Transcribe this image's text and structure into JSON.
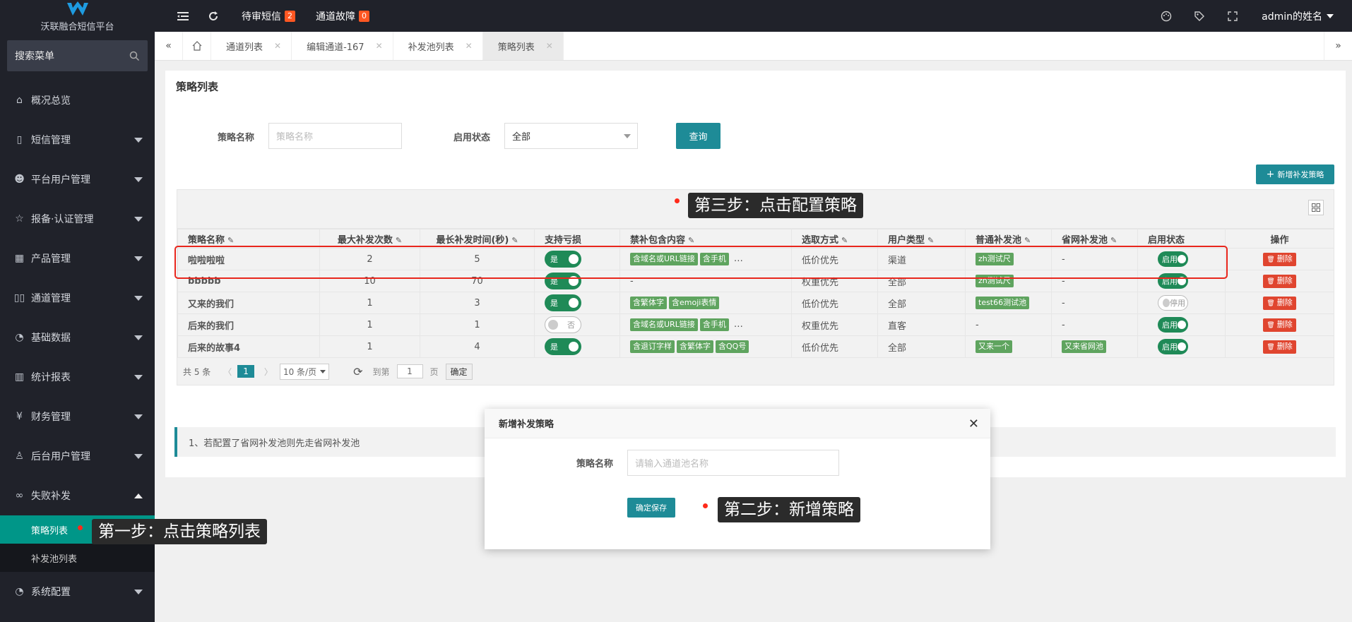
{
  "app": {
    "name": "沃联融合短信平台",
    "brand_color": "#1e8b97"
  },
  "sidebar": {
    "search_placeholder": "搜索菜单",
    "items": [
      {
        "label": "概况总览",
        "icon": "home-icon"
      },
      {
        "label": "短信管理",
        "icon": "phone-icon"
      },
      {
        "label": "平台用户管理",
        "icon": "users-icon"
      },
      {
        "label": "报备·认证管理",
        "icon": "star-icon"
      },
      {
        "label": "产品管理",
        "icon": "grid-icon"
      },
      {
        "label": "通道管理",
        "icon": "channel-icon"
      },
      {
        "label": "基础数据",
        "icon": "data-icon"
      },
      {
        "label": "统计报表",
        "icon": "chart-icon"
      },
      {
        "label": "财务管理",
        "icon": "yen-icon"
      },
      {
        "label": "后台用户管理",
        "icon": "user-icon"
      },
      {
        "label": "失败补发",
        "icon": "link-icon"
      }
    ],
    "sub_items": [
      {
        "label": "策略列表"
      },
      {
        "label": "补发池列表"
      }
    ],
    "last_item": {
      "label": "系统配置",
      "icon": "settings-icon"
    }
  },
  "topbar": {
    "pending_sms": {
      "label": "待审短信",
      "count": "2"
    },
    "channel_fault": {
      "label": "通道故障",
      "count": "0"
    },
    "user": "admin的姓名"
  },
  "tabs": [
    {
      "label": "通道列表"
    },
    {
      "label": "编辑通道-167"
    },
    {
      "label": "补发池列表"
    },
    {
      "label": "策略列表"
    }
  ],
  "page": {
    "title": "策略列表",
    "filter": {
      "name_label": "策略名称",
      "name_placeholder": "策略名称",
      "status_label": "启用状态",
      "status_value": "全部",
      "query_button": "查询"
    },
    "add_button": "新增补发策略"
  },
  "table": {
    "headers": [
      "策略名称",
      "最大补发次数",
      "最长补发时间(秒)",
      "支持亏损",
      "禁补包含内容",
      "选取方式",
      "用户类型",
      "普通补发池",
      "省网补发池",
      "启用状态",
      "操作"
    ],
    "rows": [
      {
        "name": "啦啦啦啦",
        "max_count": "2",
        "max_time": "5",
        "loss": "是",
        "content_tags": [
          "含域名或URL链接",
          "含手机"
        ],
        "more": "…",
        "method": "低价优先",
        "user_type": "渠道",
        "pool": [
          "zh测试尺"
        ],
        "prov_pool": [],
        "prov_text": "-",
        "status": "启用",
        "status_on": true,
        "op": "删除"
      },
      {
        "name": "bbbbb",
        "max_count": "10",
        "max_time": "70",
        "loss": "是",
        "content_tags": [],
        "content_text": "-",
        "method": "权重优先",
        "user_type": "全部",
        "pool": [
          "zh测试尺"
        ],
        "prov_pool": [],
        "prov_text": "-",
        "status": "启用",
        "status_on": true,
        "op": "删除"
      },
      {
        "name": "又来的我们",
        "max_count": "1",
        "max_time": "3",
        "loss": "是",
        "content_tags": [
          "含繁体字",
          "含emoji表情"
        ],
        "method": "低价优先",
        "user_type": "全部",
        "pool": [
          "test66测试池"
        ],
        "prov_pool": [],
        "prov_text": "-",
        "status": "停用",
        "status_on": false,
        "op": "删除"
      },
      {
        "name": "后来的我们",
        "max_count": "1",
        "max_time": "1",
        "loss": "否",
        "loss_off": true,
        "content_tags": [
          "含域名或URL链接",
          "含手机"
        ],
        "more": "…",
        "method": "权重优先",
        "user_type": "直客",
        "pool": [],
        "pool_text": "-",
        "prov_pool": [],
        "prov_text": "-",
        "status": "启用",
        "status_on": true,
        "op": "删除"
      },
      {
        "name": "后来的故事4",
        "max_count": "1",
        "max_time": "4",
        "loss": "是",
        "content_tags": [
          "含退订字样",
          "含繁体字",
          "含QQ号"
        ],
        "method": "低价优先",
        "user_type": "全部",
        "pool": [
          "又来一个"
        ],
        "prov_pool": [
          "又来省网池"
        ],
        "status": "启用",
        "status_on": true,
        "op": "删除"
      }
    ],
    "pagination": {
      "total": "共 5 条",
      "page": "1",
      "page_size": "10 条/页",
      "goto_label": "到第",
      "goto_value": "1",
      "page_unit": "页",
      "confirm": "确定"
    }
  },
  "note": "1、若配置了省网补发池则先走省网补发池",
  "modal": {
    "title": "新增补发策略",
    "field_label": "策略名称",
    "field_placeholder": "请输入通道池名称",
    "save_button": "确定保存"
  },
  "callouts": {
    "step1": "第一步：点击策略列表",
    "step2": "第二步：新增策略",
    "step3": "第三步：点击配置策略"
  }
}
